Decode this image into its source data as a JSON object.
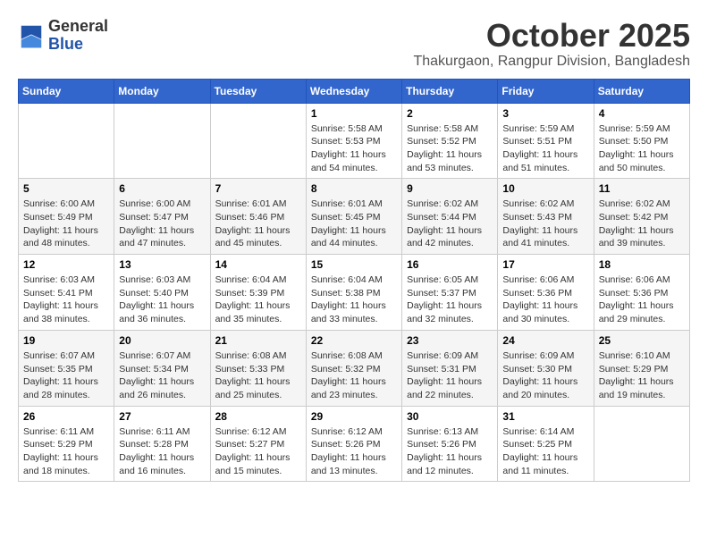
{
  "header": {
    "logo_line1": "General",
    "logo_line2": "Blue",
    "month": "October 2025",
    "location": "Thakurgaon, Rangpur Division, Bangladesh"
  },
  "weekdays": [
    "Sunday",
    "Monday",
    "Tuesday",
    "Wednesday",
    "Thursday",
    "Friday",
    "Saturday"
  ],
  "weeks": [
    [
      {
        "day": "",
        "info": ""
      },
      {
        "day": "",
        "info": ""
      },
      {
        "day": "",
        "info": ""
      },
      {
        "day": "1",
        "info": "Sunrise: 5:58 AM\nSunset: 5:53 PM\nDaylight: 11 hours\nand 54 minutes."
      },
      {
        "day": "2",
        "info": "Sunrise: 5:58 AM\nSunset: 5:52 PM\nDaylight: 11 hours\nand 53 minutes."
      },
      {
        "day": "3",
        "info": "Sunrise: 5:59 AM\nSunset: 5:51 PM\nDaylight: 11 hours\nand 51 minutes."
      },
      {
        "day": "4",
        "info": "Sunrise: 5:59 AM\nSunset: 5:50 PM\nDaylight: 11 hours\nand 50 minutes."
      }
    ],
    [
      {
        "day": "5",
        "info": "Sunrise: 6:00 AM\nSunset: 5:49 PM\nDaylight: 11 hours\nand 48 minutes."
      },
      {
        "day": "6",
        "info": "Sunrise: 6:00 AM\nSunset: 5:47 PM\nDaylight: 11 hours\nand 47 minutes."
      },
      {
        "day": "7",
        "info": "Sunrise: 6:01 AM\nSunset: 5:46 PM\nDaylight: 11 hours\nand 45 minutes."
      },
      {
        "day": "8",
        "info": "Sunrise: 6:01 AM\nSunset: 5:45 PM\nDaylight: 11 hours\nand 44 minutes."
      },
      {
        "day": "9",
        "info": "Sunrise: 6:02 AM\nSunset: 5:44 PM\nDaylight: 11 hours\nand 42 minutes."
      },
      {
        "day": "10",
        "info": "Sunrise: 6:02 AM\nSunset: 5:43 PM\nDaylight: 11 hours\nand 41 minutes."
      },
      {
        "day": "11",
        "info": "Sunrise: 6:02 AM\nSunset: 5:42 PM\nDaylight: 11 hours\nand 39 minutes."
      }
    ],
    [
      {
        "day": "12",
        "info": "Sunrise: 6:03 AM\nSunset: 5:41 PM\nDaylight: 11 hours\nand 38 minutes."
      },
      {
        "day": "13",
        "info": "Sunrise: 6:03 AM\nSunset: 5:40 PM\nDaylight: 11 hours\nand 36 minutes."
      },
      {
        "day": "14",
        "info": "Sunrise: 6:04 AM\nSunset: 5:39 PM\nDaylight: 11 hours\nand 35 minutes."
      },
      {
        "day": "15",
        "info": "Sunrise: 6:04 AM\nSunset: 5:38 PM\nDaylight: 11 hours\nand 33 minutes."
      },
      {
        "day": "16",
        "info": "Sunrise: 6:05 AM\nSunset: 5:37 PM\nDaylight: 11 hours\nand 32 minutes."
      },
      {
        "day": "17",
        "info": "Sunrise: 6:06 AM\nSunset: 5:36 PM\nDaylight: 11 hours\nand 30 minutes."
      },
      {
        "day": "18",
        "info": "Sunrise: 6:06 AM\nSunset: 5:36 PM\nDaylight: 11 hours\nand 29 minutes."
      }
    ],
    [
      {
        "day": "19",
        "info": "Sunrise: 6:07 AM\nSunset: 5:35 PM\nDaylight: 11 hours\nand 28 minutes."
      },
      {
        "day": "20",
        "info": "Sunrise: 6:07 AM\nSunset: 5:34 PM\nDaylight: 11 hours\nand 26 minutes."
      },
      {
        "day": "21",
        "info": "Sunrise: 6:08 AM\nSunset: 5:33 PM\nDaylight: 11 hours\nand 25 minutes."
      },
      {
        "day": "22",
        "info": "Sunrise: 6:08 AM\nSunset: 5:32 PM\nDaylight: 11 hours\nand 23 minutes."
      },
      {
        "day": "23",
        "info": "Sunrise: 6:09 AM\nSunset: 5:31 PM\nDaylight: 11 hours\nand 22 minutes."
      },
      {
        "day": "24",
        "info": "Sunrise: 6:09 AM\nSunset: 5:30 PM\nDaylight: 11 hours\nand 20 minutes."
      },
      {
        "day": "25",
        "info": "Sunrise: 6:10 AM\nSunset: 5:29 PM\nDaylight: 11 hours\nand 19 minutes."
      }
    ],
    [
      {
        "day": "26",
        "info": "Sunrise: 6:11 AM\nSunset: 5:29 PM\nDaylight: 11 hours\nand 18 minutes."
      },
      {
        "day": "27",
        "info": "Sunrise: 6:11 AM\nSunset: 5:28 PM\nDaylight: 11 hours\nand 16 minutes."
      },
      {
        "day": "28",
        "info": "Sunrise: 6:12 AM\nSunset: 5:27 PM\nDaylight: 11 hours\nand 15 minutes."
      },
      {
        "day": "29",
        "info": "Sunrise: 6:12 AM\nSunset: 5:26 PM\nDaylight: 11 hours\nand 13 minutes."
      },
      {
        "day": "30",
        "info": "Sunrise: 6:13 AM\nSunset: 5:26 PM\nDaylight: 11 hours\nand 12 minutes."
      },
      {
        "day": "31",
        "info": "Sunrise: 6:14 AM\nSunset: 5:25 PM\nDaylight: 11 hours\nand 11 minutes."
      },
      {
        "day": "",
        "info": ""
      }
    ]
  ]
}
